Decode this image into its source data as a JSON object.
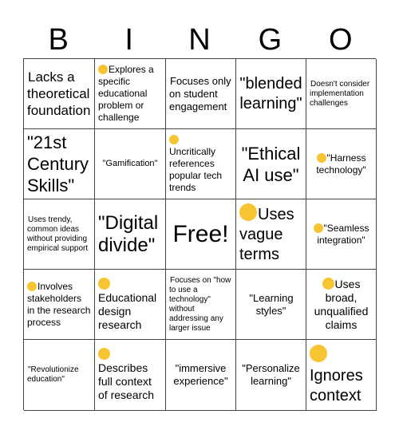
{
  "header": [
    "B",
    "I",
    "N",
    "G",
    "O"
  ],
  "cells": [
    {
      "text": "Lacks a theoretical foundation",
      "icon": "grimacing-face-icon",
      "align": "left",
      "size": "s14b"
    },
    {
      "text": "Explores a specific educational problem or challenge",
      "icon": "grinning-face-icon",
      "align": "left",
      "size": "s12"
    },
    {
      "text": "Focuses only on student engagement",
      "icon": "thinking-face-icon",
      "align": "left",
      "size": "s13"
    },
    {
      "text": "\"blended learning\"",
      "icon": "",
      "align": "center",
      "size": "s20"
    },
    {
      "text": "Doesn't consider implementation challenges",
      "icon": "grimacing-face-icon",
      "align": "left",
      "size": "s10"
    },
    {
      "text": "\"21st Century Skills\"",
      "icon": "",
      "align": "left",
      "size": "s22"
    },
    {
      "text": "\"Gamification\"",
      "icon": "",
      "align": "center",
      "size": "s11"
    },
    {
      "text": "Uncritically references popular tech trends",
      "icon": "grimacing-face-icon",
      "align": "left",
      "size": "s12",
      "icon_block": true
    },
    {
      "text": "\"Ethical AI use\"",
      "icon": "",
      "align": "center",
      "size": "s22"
    },
    {
      "text": "\"Harness technology\"",
      "icon": "face-with-rolling-eyes-icon",
      "align": "center",
      "size": "s12"
    },
    {
      "text": "Uses trendy, common ideas without providing empirical support",
      "icon": "grimacing-face-icon",
      "align": "left",
      "size": "s10"
    },
    {
      "text": "\"Digital divide\"",
      "icon": "",
      "align": "left",
      "size": "s24"
    },
    {
      "text": "Free!",
      "icon": "",
      "align": "center",
      "size": "s30"
    },
    {
      "text": "Uses vague terms",
      "icon": "grimacing-face-icon",
      "align": "left",
      "size": "s20"
    },
    {
      "text": "\"Seamless integration\"",
      "icon": "face-with-rolling-eyes-icon",
      "align": "center",
      "size": "s12"
    },
    {
      "text": "Involves stakeholders in the research process",
      "icon": "grinning-face-icon",
      "align": "left",
      "size": "s12"
    },
    {
      "text": "Educational design research",
      "icon": "grinning-face-icon",
      "align": "left",
      "size": "s14",
      "icon_block": true
    },
    {
      "text": "Focuses on \"how to use a technology\" without addressing any larger issue",
      "icon": "grimacing-face-icon",
      "align": "left",
      "size": "s10"
    },
    {
      "text": "\"Learning styles\"",
      "icon": "face-with-rolling-eyes-icon",
      "align": "center",
      "size": "s13"
    },
    {
      "text": "Uses broad, unqualified claims",
      "icon": "grimacing-face-icon",
      "align": "center",
      "size": "s14"
    },
    {
      "text": "\"Revolutionize education\"",
      "icon": "face-with-rolling-eyes-icon",
      "align": "left",
      "size": "s10"
    },
    {
      "text": "Describes full context of research",
      "icon": "grinning-face-icon",
      "align": "left",
      "size": "s14",
      "icon_block": true
    },
    {
      "text": "\"immersive experience\"",
      "icon": "",
      "align": "center",
      "size": "s13"
    },
    {
      "text": "\"Personalize learning\"",
      "icon": "",
      "align": "center",
      "size": "s13"
    },
    {
      "text": "Ignores context",
      "icon": "grimacing-face-icon",
      "align": "left",
      "size": "s20",
      "icon_block": true
    }
  ],
  "colors": {
    "emoji": "#f7c531",
    "grid_line": "#444444"
  }
}
